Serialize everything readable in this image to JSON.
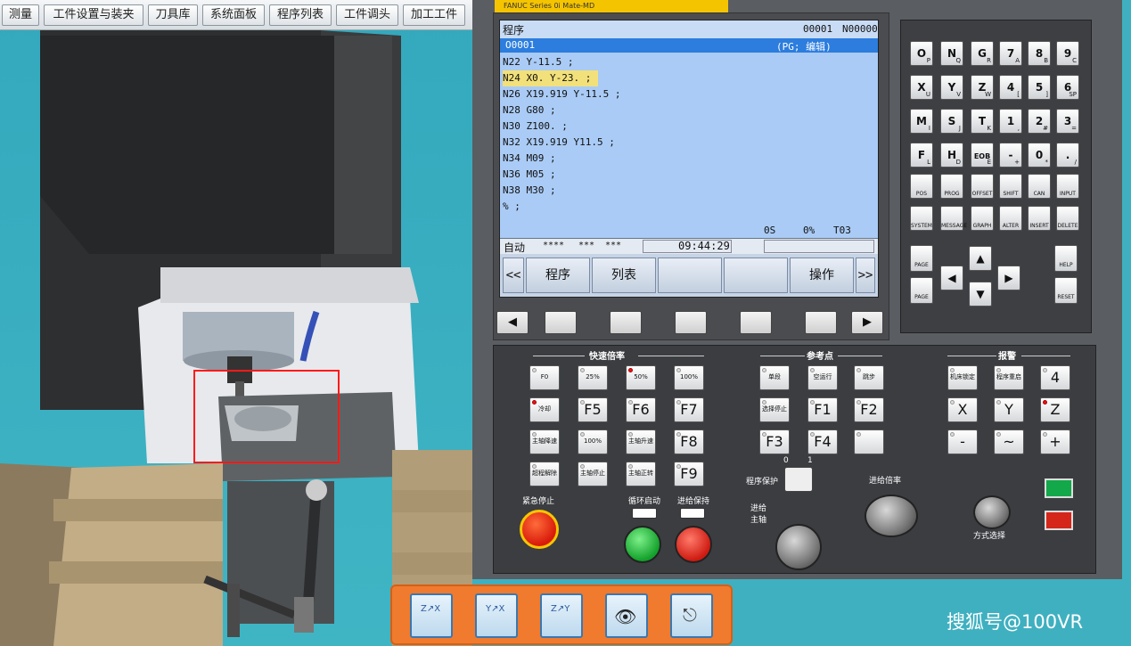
{
  "toolbar": [
    "测量",
    "工件设置与装夹",
    "刀具库",
    "系统面板",
    "程序列表",
    "工件调头",
    "加工工件"
  ],
  "yellow_tab": "FANUC  Series  0i  Mate-MD",
  "screen": {
    "title": "程序",
    "prog_num": "00001",
    "seq_num": "N00000",
    "program_name": "O0001",
    "mode_hint": "(PG; 编辑)",
    "lines": [
      "N22 Y-11.5 ;",
      "N24 X0. Y-23. ;",
      "N26 X19.919 Y-11.5 ;",
      "N28 G80 ;",
      "N30 Z100. ;",
      "N32 X19.919 Y11.5 ;",
      "N34 M09 ;",
      "N36 M05 ;",
      "N38 M30 ;",
      "% ;"
    ],
    "highlight_line": 1,
    "s_value": "0S",
    "percent": "0%",
    "tool": "T03",
    "mode": "自动",
    "stars1": "****",
    "stars2": "***",
    "stars3": "***",
    "clock": "09:44:29",
    "softkeys": [
      "<<",
      "程序",
      "列表",
      "",
      "",
      "操作",
      ">>"
    ]
  },
  "keypad": {
    "rows": [
      [
        {
          "m": "O",
          "s": "P"
        },
        {
          "m": "N",
          "s": "Q"
        },
        {
          "m": "G",
          "s": "R"
        },
        {
          "m": "7",
          "s": "A"
        },
        {
          "m": "8",
          "s": "B"
        },
        {
          "m": "9",
          "s": "C"
        }
      ],
      [
        {
          "m": "X",
          "s": "U"
        },
        {
          "m": "Y",
          "s": "V"
        },
        {
          "m": "Z",
          "s": "W"
        },
        {
          "m": "4",
          "s": "["
        },
        {
          "m": "5",
          "s": "]"
        },
        {
          "m": "6",
          "s": "SP"
        }
      ],
      [
        {
          "m": "M",
          "s": "I"
        },
        {
          "m": "S",
          "s": "J"
        },
        {
          "m": "T",
          "s": "K"
        },
        {
          "m": "1",
          "s": ","
        },
        {
          "m": "2",
          "s": "#"
        },
        {
          "m": "3",
          "s": "="
        }
      ],
      [
        {
          "m": "F",
          "s": "L"
        },
        {
          "m": "H",
          "s": "D"
        },
        {
          "m": "EOB",
          "s": "E"
        },
        {
          "m": "-",
          "s": "+"
        },
        {
          "m": "0",
          "s": "*"
        },
        {
          "m": ".",
          "s": "/"
        }
      ]
    ],
    "func_row1": [
      "POS",
      "PROG",
      "OFFSET",
      "SHIFT",
      "CAN",
      "INPUT"
    ],
    "func_row2": [
      "SYSTEM",
      "MESSAGE",
      "GRAPH",
      "ALTER",
      "INSERT",
      "DELETE"
    ],
    "page_up": "PAGE",
    "page_down": "PAGE",
    "help": "HELP",
    "reset": "RESET"
  },
  "panel": {
    "sec_rapid": "快速倍率",
    "sec_ref": "参考点",
    "sec_alarm": "报警",
    "rapid": [
      "F0",
      "25%",
      "50%",
      "100%"
    ],
    "emergency": "紧急停止",
    "cycle_start": "循环启动",
    "feed_hold": "进给保持",
    "prog_protect": "程序保护",
    "feed_rate": "进给倍率",
    "mode_select": "方式选择",
    "feed_label": "进给",
    "spindle_label": "主轴",
    "zero": "0",
    "one": "1",
    "fkeys": [
      "F5",
      "F6",
      "F7",
      "F8",
      "F9",
      "F1",
      "F2",
      "F3",
      "F4"
    ],
    "axis": [
      "4",
      "X",
      "Y",
      "Z",
      "-",
      "~",
      "+"
    ],
    "small_labels": [
      "冷却",
      "主轴降速",
      "100%",
      "主轴升速",
      "超程解除",
      "主轴停止",
      "主轴正转",
      "单段",
      "空运行",
      "跳步",
      "选择停止",
      "机床锁定",
      "程序重启"
    ]
  },
  "watermark": "搜狐号@100VR"
}
